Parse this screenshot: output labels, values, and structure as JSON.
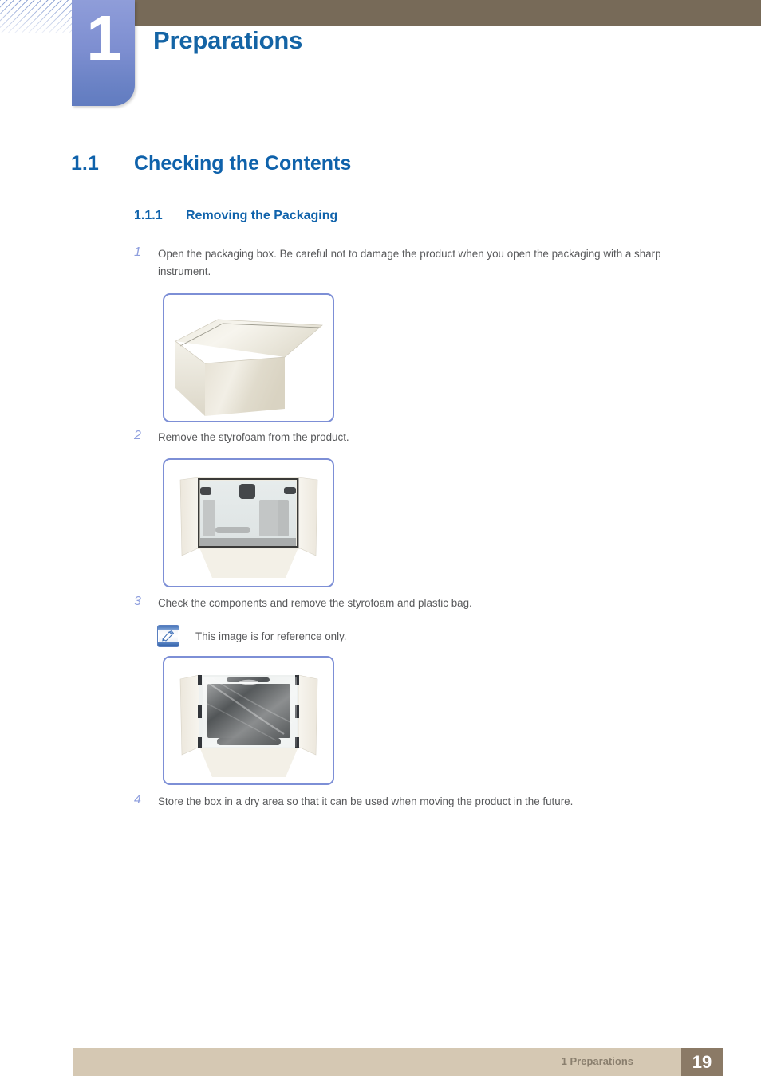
{
  "page": {
    "chapter_number": "1",
    "chapter_title": "Preparations"
  },
  "section": {
    "number": "1.1",
    "title": "Checking the Contents"
  },
  "subsection": {
    "number": "1.1.1",
    "title": "Removing the Packaging"
  },
  "steps": [
    {
      "number": "1",
      "text": "Open the packaging box. Be careful not to damage the product when you open the packaging with a sharp instrument."
    },
    {
      "number": "2",
      "text": "Remove the styrofoam from the product."
    },
    {
      "number": "3",
      "text": "Check the components and remove the styrofoam and plastic bag."
    },
    {
      "number": "4",
      "text": "Store the box in a dry area so that it can be used when moving the product in the future."
    }
  ],
  "note": {
    "icon": "note-pencil-icon",
    "text": "This image is for reference only."
  },
  "figures": [
    {
      "name": "closed-packaging-box",
      "caption": ""
    },
    {
      "name": "open-box-with-styrofoam",
      "caption": ""
    },
    {
      "name": "open-box-with-monitor-in-plastic-bag",
      "caption": ""
    }
  ],
  "footer": {
    "label": "1 Preparations",
    "page_number": "19"
  },
  "colors": {
    "header_bar": "#776a58",
    "chapter_tab_top": "#8f9dd9",
    "chapter_tab_bottom": "#617cc0",
    "heading_blue": "#0f62ab",
    "title_blue": "#1464a5",
    "step_number_blue": "#8e9ede",
    "body_text": "#58595b",
    "figure_border": "#7d8fd6",
    "footer_bar": "#d5c8b3",
    "footer_page_box": "#8b7a66"
  }
}
